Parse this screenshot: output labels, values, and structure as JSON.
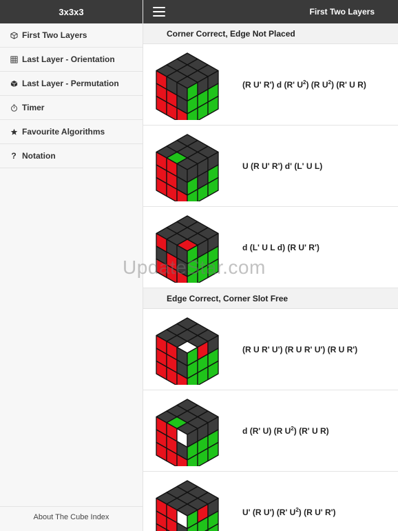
{
  "sidebar": {
    "title": "3x3x3",
    "items": [
      {
        "label": "First Two Layers",
        "icon": "cube-outline-icon"
      },
      {
        "label": "Last Layer - Orientation",
        "icon": "grid-icon"
      },
      {
        "label": "Last Layer - Permutation",
        "icon": "cube-solid-icon"
      },
      {
        "label": "Timer",
        "icon": "stopwatch-icon"
      },
      {
        "label": "Favourite Algorithms",
        "icon": "star-icon"
      },
      {
        "label": "Notation",
        "icon": "question-icon"
      }
    ],
    "footer": "About The Cube Index"
  },
  "topbar": {
    "title": "First Two Layers",
    "menu_icon": "hamburger-icon"
  },
  "sections": [
    {
      "title": "Corner Correct, Edge Not Placed",
      "rows": [
        {
          "alg": "(R U' R') d (R' U2) (R U2) (R' U R)"
        },
        {
          "alg": "U (R U' R') d' (L' U L)"
        },
        {
          "alg": "d (L' U L d) (R U' R')"
        }
      ]
    },
    {
      "title": "Edge Correct, Corner Slot Free",
      "rows": [
        {
          "alg": "(R U R' U') (R U R' U') (R U R')"
        },
        {
          "alg": "d (R' U) (R U2) (R' U R)"
        },
        {
          "alg": "U' (R U') (R' U2) (R U' R')"
        }
      ]
    }
  ],
  "watermark": "UpdateStar.com",
  "colors": {
    "dark": "#3a3a3a",
    "cube_gray": "#3c3c3c",
    "red": "#e8121c",
    "green": "#1fc31a",
    "white": "#ffffff"
  }
}
